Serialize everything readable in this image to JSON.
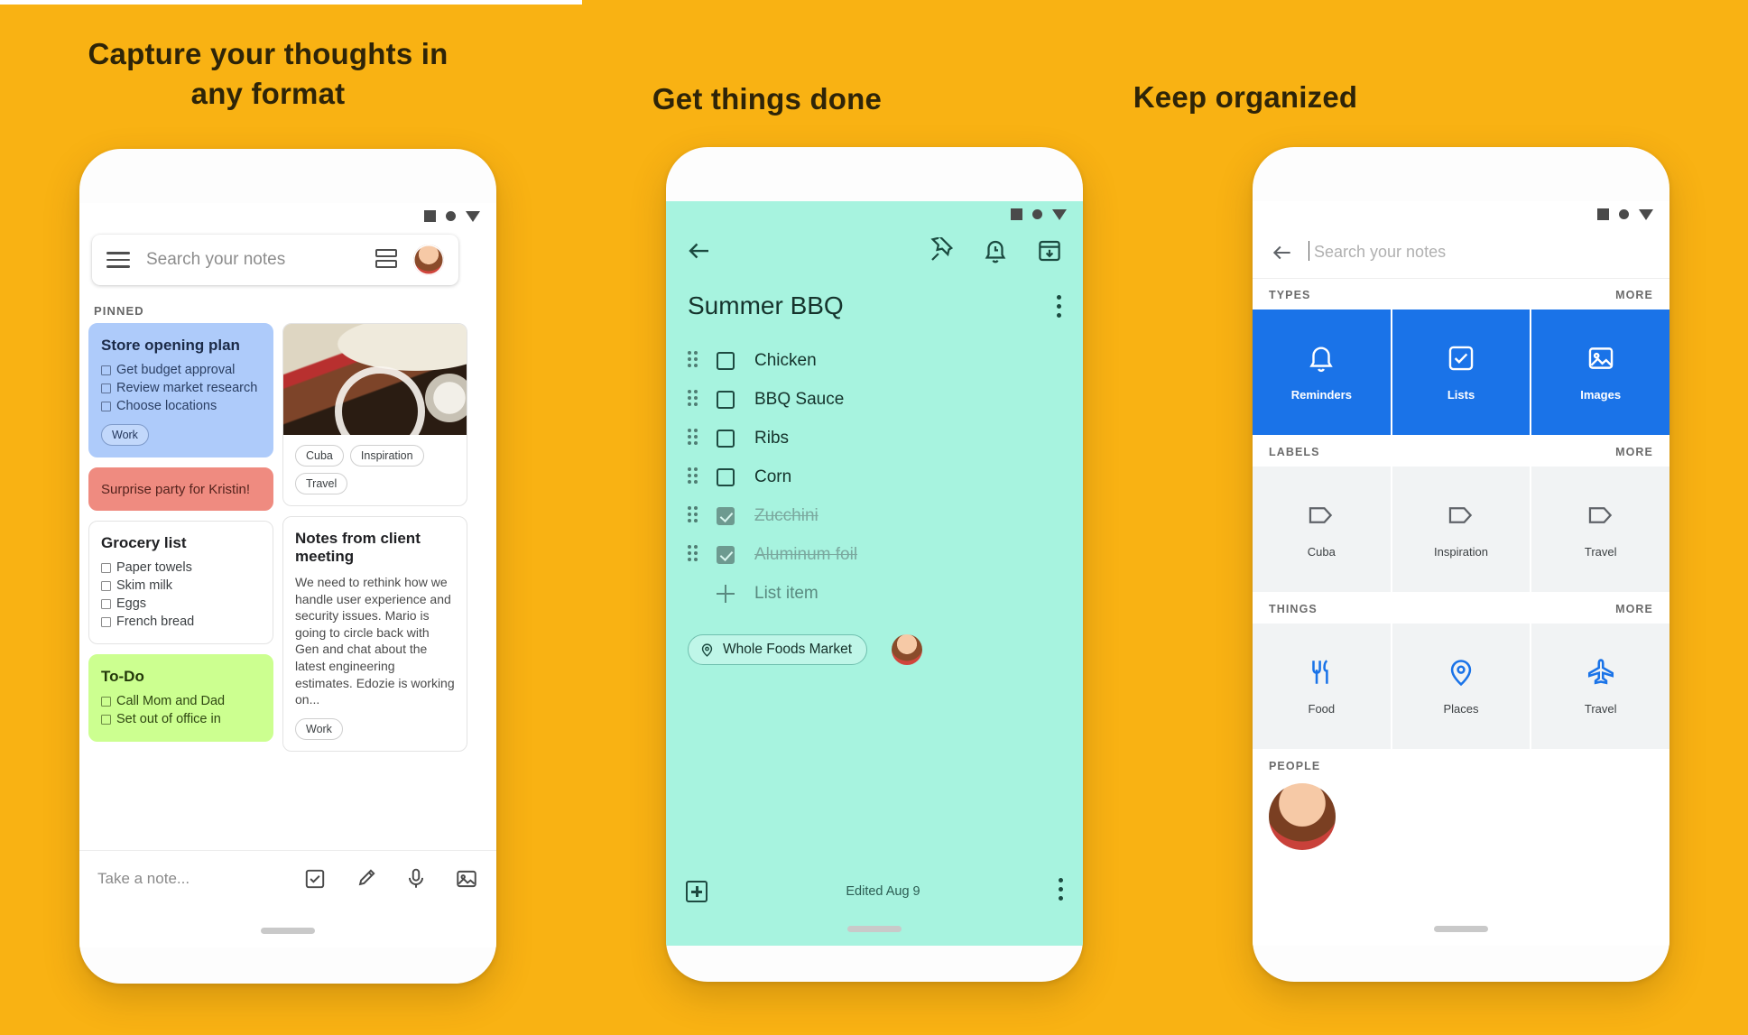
{
  "page": {
    "background_color": "#F9B213",
    "headings": [
      {
        "id": "h1",
        "text": "Capture your thoughts in any format"
      },
      {
        "id": "h2",
        "text": "Get things done"
      },
      {
        "id": "h3",
        "text": "Keep organized"
      }
    ]
  },
  "phone1": {
    "search": {
      "placeholder": "Search your notes"
    },
    "section_label": "PINNED",
    "notes": [
      {
        "title": "Store opening plan",
        "color": "#aecbfa",
        "items": [
          "Get budget approval",
          "Review market research",
          "Choose locations"
        ],
        "labels": [
          "Work"
        ]
      },
      {
        "title": "Surprise party for Kristin!",
        "color": "#ef8b80",
        "items": [],
        "labels": []
      },
      {
        "title": "Grocery list",
        "color": "#ffffff",
        "items": [
          "Paper towels",
          "Skim milk",
          "Eggs",
          "French bread"
        ],
        "labels": []
      },
      {
        "title": "To-Do",
        "color": "#ccff90",
        "items": [
          "Call Mom and Dad",
          "Set out of office in"
        ],
        "labels": []
      },
      {
        "title": "",
        "color": "#ffffff",
        "photo": true,
        "items": [],
        "labels": [
          "Cuba",
          "Inspiration",
          "Travel"
        ]
      },
      {
        "title": "Notes from client meeting",
        "color": "#ffffff",
        "body": "We need to rethink how we handle user experience and security issues. Mario is going to circle back with Gen and chat about the latest engineering estimates. Edozie is working on...",
        "labels": [
          "Work"
        ]
      }
    ],
    "compose": {
      "placeholder": "Take a note...",
      "icons": [
        "checkbox-icon",
        "brush-icon",
        "microphone-icon",
        "image-icon"
      ]
    }
  },
  "phone2": {
    "background_color": "#a7f3df",
    "toolbar_icons": [
      "back-arrow-icon",
      "pin-icon",
      "reminder-bell-icon",
      "archive-icon"
    ],
    "title": "Summer BBQ",
    "overflow_icon": "more-vertical-icon",
    "list_items": [
      {
        "text": "Chicken",
        "checked": false
      },
      {
        "text": "BBQ Sauce",
        "checked": false
      },
      {
        "text": "Ribs",
        "checked": false
      },
      {
        "text": "Corn",
        "checked": false
      },
      {
        "text": "Zucchini",
        "checked": true
      },
      {
        "text": "Aluminum foil",
        "checked": true
      }
    ],
    "add_item_label": "List item",
    "location_chip": "Whole Foods Market",
    "footer": {
      "edited": "Edited Aug 9"
    }
  },
  "phone3": {
    "search": {
      "placeholder": "Search your notes",
      "back_icon": "back-arrow-icon"
    },
    "sections": [
      {
        "label": "TYPES",
        "more": "MORE",
        "style": "blue",
        "tiles": [
          {
            "label": "Reminders",
            "icon": "bell-icon"
          },
          {
            "label": "Lists",
            "icon": "checkbox-icon"
          },
          {
            "label": "Images",
            "icon": "image-icon"
          }
        ]
      },
      {
        "label": "LABELS",
        "more": "MORE",
        "style": "grey",
        "tiles": [
          {
            "label": "Cuba",
            "icon": "label-tag-icon"
          },
          {
            "label": "Inspiration",
            "icon": "label-tag-icon"
          },
          {
            "label": "Travel",
            "icon": "label-tag-icon"
          }
        ]
      },
      {
        "label": "THINGS",
        "more": "MORE",
        "style": "grey",
        "tiles": [
          {
            "label": "Food",
            "icon": "restaurant-icon"
          },
          {
            "label": "Places",
            "icon": "place-pin-icon"
          },
          {
            "label": "Travel",
            "icon": "airplane-icon"
          }
        ]
      },
      {
        "label": "PEOPLE",
        "more": "",
        "style": "people",
        "tiles": []
      }
    ]
  }
}
